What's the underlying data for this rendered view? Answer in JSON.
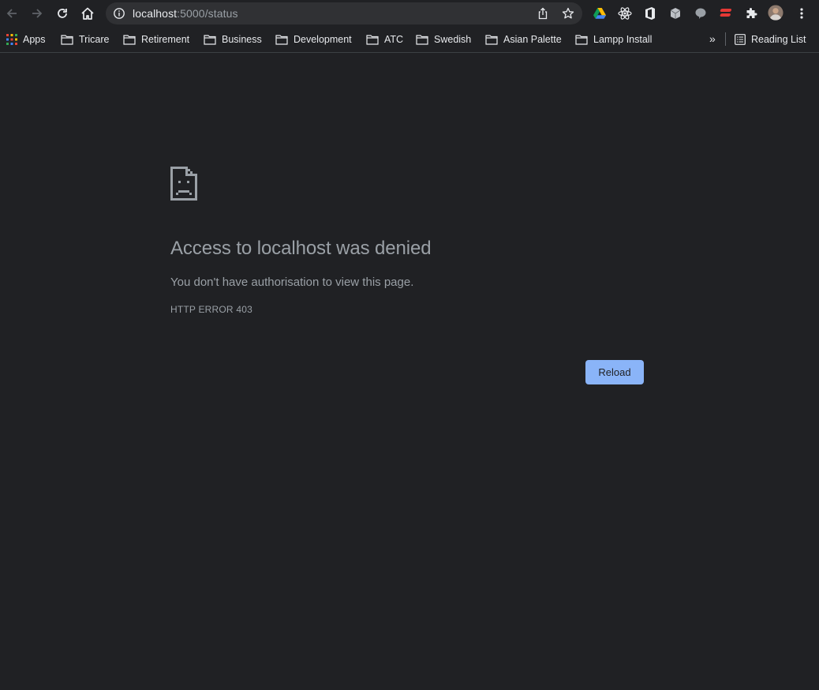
{
  "toolbar": {
    "url_host": "localhost",
    "url_path": ":5000/status"
  },
  "bookmarks": {
    "apps_label": "Apps",
    "folders": [
      {
        "label": "Tricare"
      },
      {
        "label": "Retirement"
      },
      {
        "label": "Business"
      },
      {
        "label": "Development"
      },
      {
        "label": "ATC"
      },
      {
        "label": "Swedish"
      },
      {
        "label": "Asian Palette"
      },
      {
        "label": "Lampp Install"
      }
    ],
    "overflow_label": "»",
    "reading_list_label": "Reading List"
  },
  "page": {
    "icon": "sad-document-icon",
    "heading": "Access to localhost was denied",
    "message": "You don't have authorisation to view this page.",
    "error_code": "HTTP ERROR 403",
    "reload_label": "Reload"
  },
  "colors": {
    "background": "#202124",
    "text_secondary": "#9aa0a6",
    "accent_button": "#8ab4f8"
  }
}
